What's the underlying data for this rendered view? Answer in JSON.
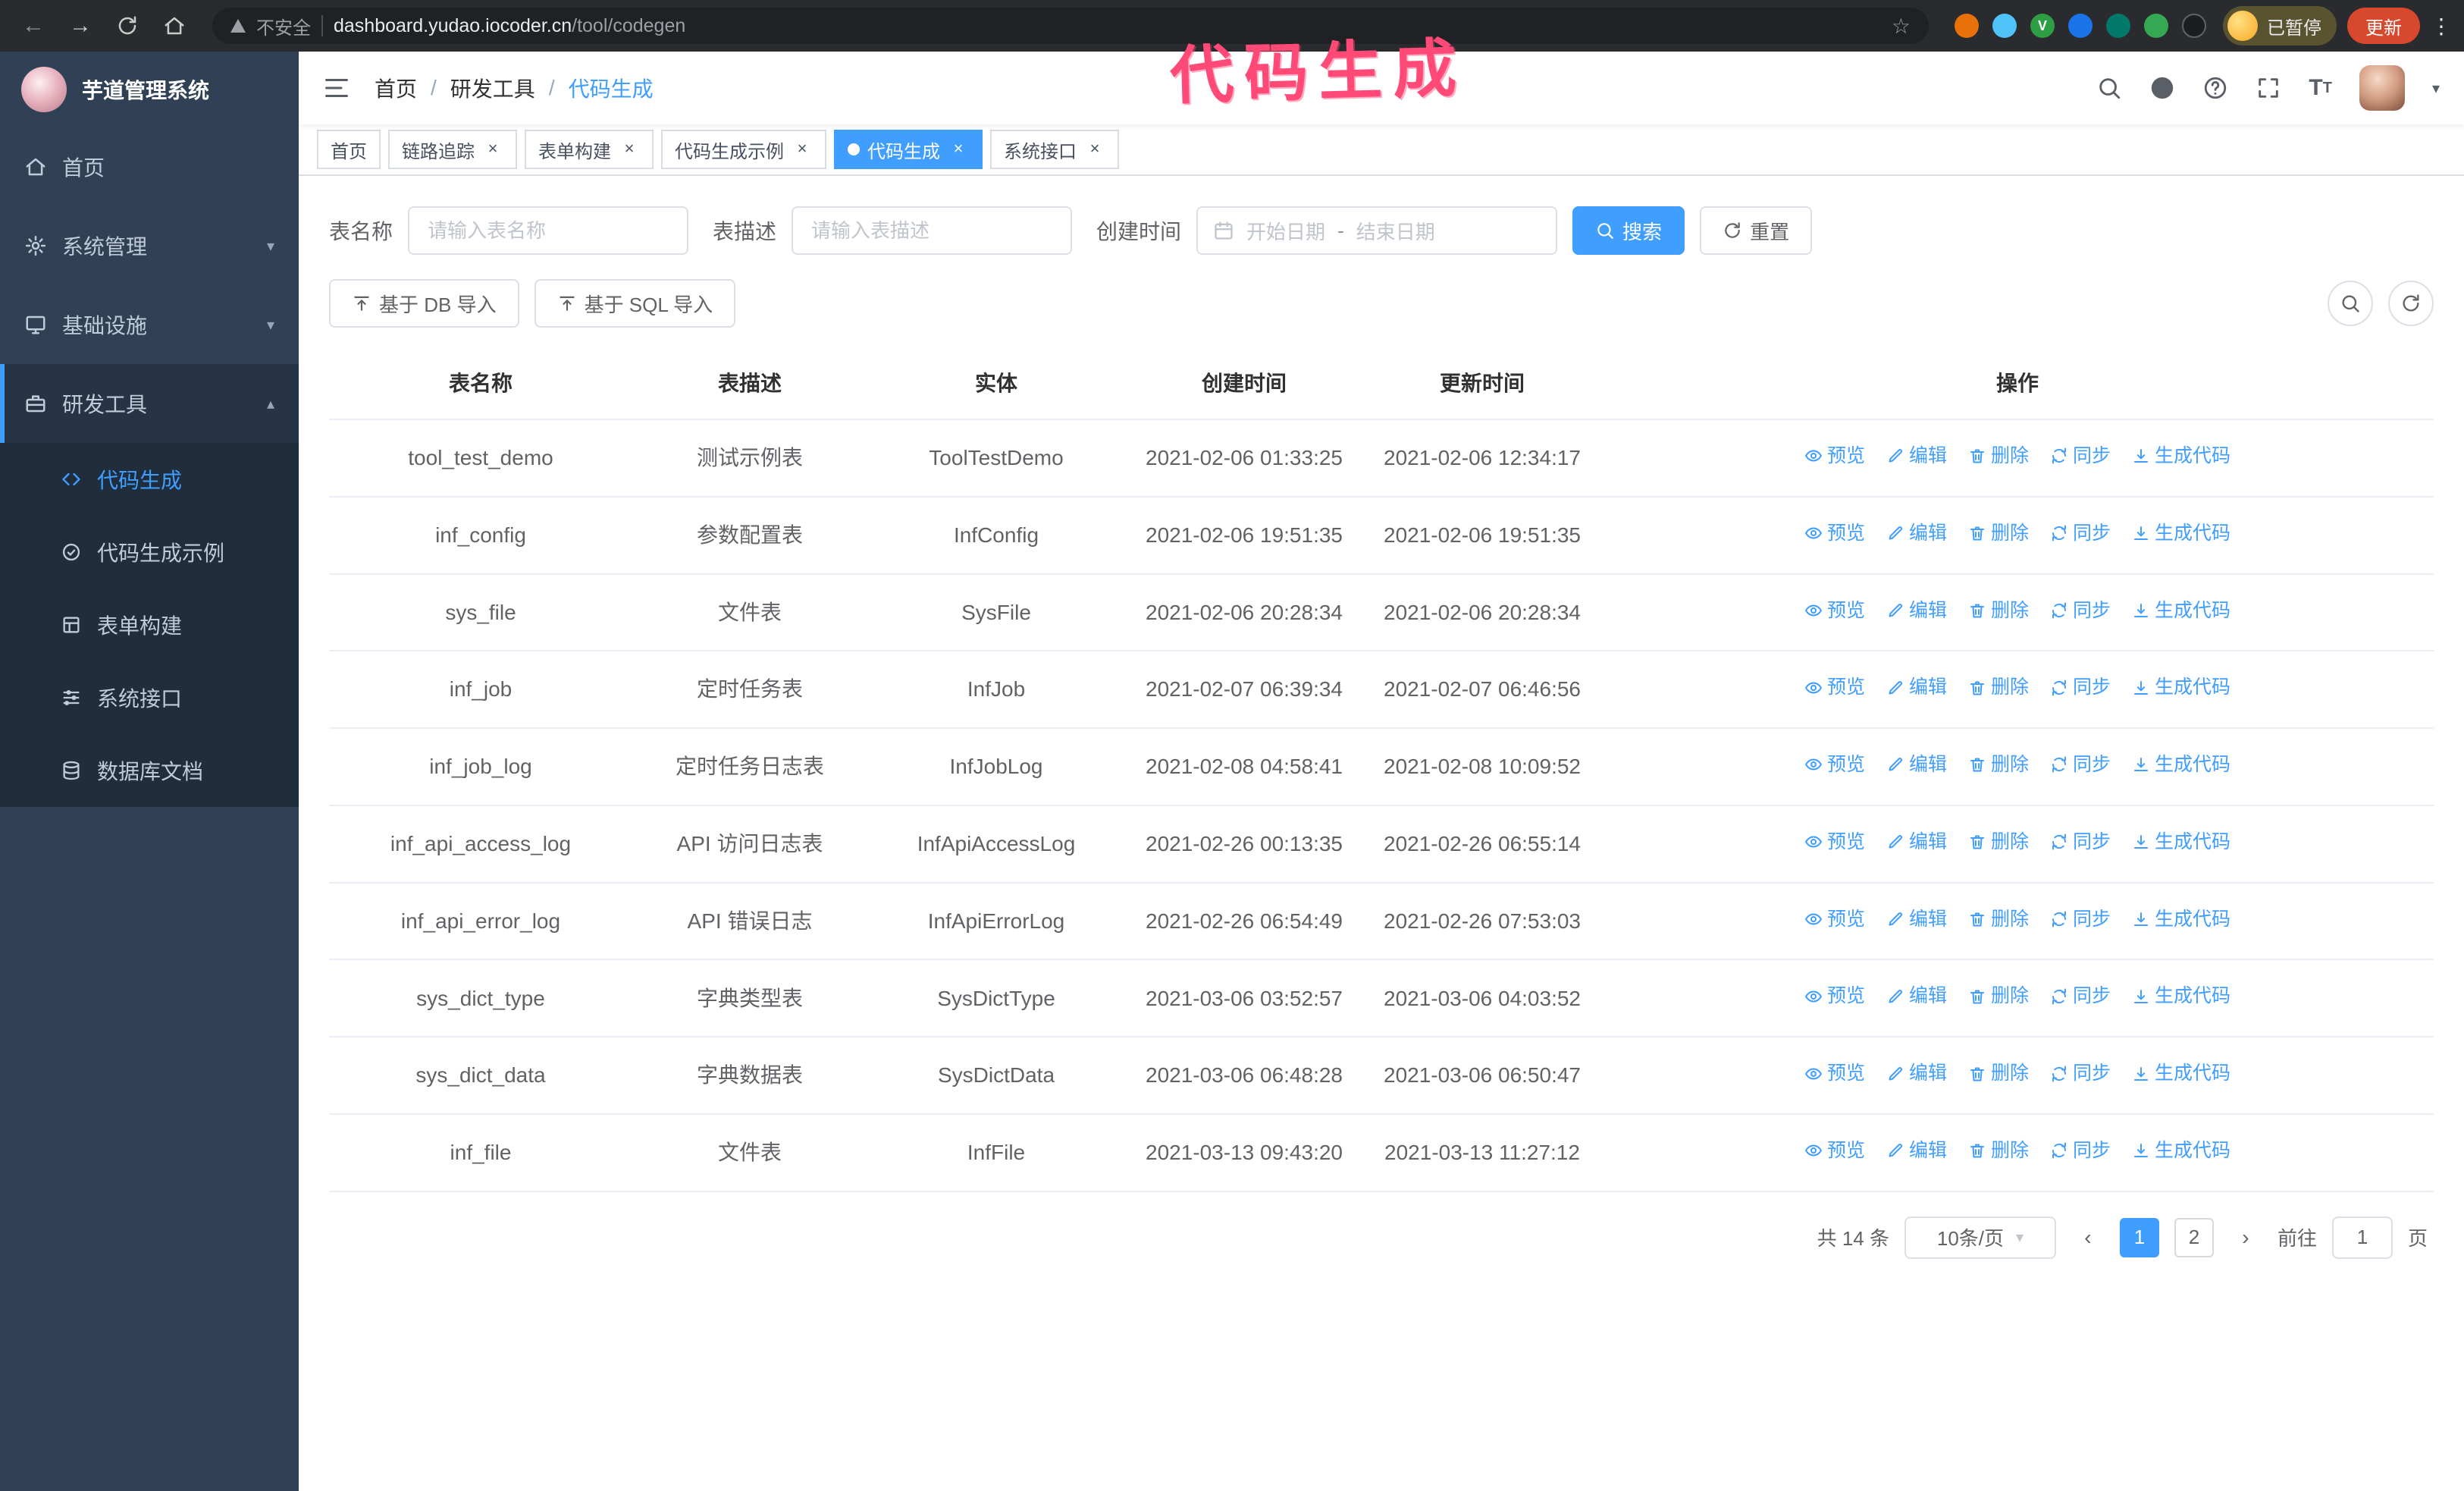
{
  "browser": {
    "security_text": "不安全",
    "url_host": "dashboard.yudao.iocoder.cn",
    "url_path": "/tool/codegen",
    "profile_status": "已暂停",
    "update_label": "更新"
  },
  "annotation": {
    "text": "代码生成",
    "color": "#ff4a78"
  },
  "sidebar": {
    "logo_title": "芋道管理系统",
    "items": [
      {
        "label": "首页",
        "icon": "home-icon"
      },
      {
        "label": "系统管理",
        "icon": "gear-icon"
      },
      {
        "label": "基础设施",
        "icon": "monitor-icon"
      },
      {
        "label": "研发工具",
        "icon": "toolbox-icon",
        "expanded": true
      }
    ],
    "sub_items": [
      {
        "label": "代码生成",
        "icon": "code-icon",
        "active": true
      },
      {
        "label": "代码生成示例",
        "icon": "example-icon"
      },
      {
        "label": "表单构建",
        "icon": "form-icon"
      },
      {
        "label": "系统接口",
        "icon": "api-icon"
      },
      {
        "label": "数据库文档",
        "icon": "database-icon"
      }
    ]
  },
  "breadcrumb": {
    "separator": "/",
    "items": [
      "首页",
      "研发工具",
      "代码生成"
    ]
  },
  "tabs": [
    {
      "label": "首页",
      "closable": false,
      "active": false
    },
    {
      "label": "链路追踪",
      "closable": true,
      "active": false
    },
    {
      "label": "表单构建",
      "closable": true,
      "active": false
    },
    {
      "label": "代码生成示例",
      "closable": true,
      "active": false
    },
    {
      "label": "代码生成",
      "closable": true,
      "active": true
    },
    {
      "label": "系统接口",
      "closable": true,
      "active": false
    }
  ],
  "filters": {
    "table_name_label": "表名称",
    "table_name_placeholder": "请输入表名称",
    "table_desc_label": "表描述",
    "table_desc_placeholder": "请输入表描述",
    "create_time_label": "创建时间",
    "date_start_placeholder": "开始日期",
    "date_separator": "-",
    "date_end_placeholder": "结束日期",
    "search_label": "搜索",
    "reset_label": "重置"
  },
  "toolbar": {
    "import_db_label": "基于 DB 导入",
    "import_sql_label": "基于 SQL 导入"
  },
  "table": {
    "columns": [
      "表名称",
      "表描述",
      "实体",
      "创建时间",
      "更新时间",
      "操作"
    ],
    "actions": [
      {
        "id": "preview",
        "label": "预览",
        "icon": "i-eye"
      },
      {
        "id": "edit",
        "label": "编辑",
        "icon": "i-edit"
      },
      {
        "id": "delete",
        "label": "删除",
        "icon": "i-trash"
      },
      {
        "id": "sync",
        "label": "同步",
        "icon": "i-sync"
      },
      {
        "id": "generate",
        "label": "生成代码",
        "icon": "i-download"
      }
    ],
    "rows": [
      {
        "name": "tool_test_demo",
        "desc": "测试示例表",
        "entity": "ToolTestDemo",
        "created": "2021-02-06 01:33:25",
        "updated": "2021-02-06 12:34:17"
      },
      {
        "name": "inf_config",
        "desc": "参数配置表",
        "entity": "InfConfig",
        "created": "2021-02-06 19:51:35",
        "updated": "2021-02-06 19:51:35"
      },
      {
        "name": "sys_file",
        "desc": "文件表",
        "entity": "SysFile",
        "created": "2021-02-06 20:28:34",
        "updated": "2021-02-06 20:28:34"
      },
      {
        "name": "inf_job",
        "desc": "定时任务表",
        "entity": "InfJob",
        "created": "2021-02-07 06:39:34",
        "updated": "2021-02-07 06:46:56"
      },
      {
        "name": "inf_job_log",
        "desc": "定时任务日志表",
        "entity": "InfJobLog",
        "created": "2021-02-08 04:58:41",
        "updated": "2021-02-08 10:09:52"
      },
      {
        "name": "inf_api_access_log",
        "desc": "API 访问日志表",
        "entity": "InfApiAccessLog",
        "created": "2021-02-26 00:13:35",
        "updated": "2021-02-26 06:55:14"
      },
      {
        "name": "inf_api_error_log",
        "desc": "API 错误日志",
        "entity": "InfApiErrorLog",
        "created": "2021-02-26 06:54:49",
        "updated": "2021-02-26 07:53:03"
      },
      {
        "name": "sys_dict_type",
        "desc": "字典类型表",
        "entity": "SysDictType",
        "created": "2021-03-06 03:52:57",
        "updated": "2021-03-06 04:03:52"
      },
      {
        "name": "sys_dict_data",
        "desc": "字典数据表",
        "entity": "SysDictData",
        "created": "2021-03-06 06:48:28",
        "updated": "2021-03-06 06:50:47"
      },
      {
        "name": "inf_file",
        "desc": "文件表",
        "entity": "InfFile",
        "created": "2021-03-13 09:43:20",
        "updated": "2021-03-13 11:27:12"
      }
    ]
  },
  "pagination": {
    "total_text": "共 14 条",
    "page_size": "10条/页",
    "pages": [
      "1",
      "2"
    ],
    "active_page": "1",
    "goto_label": "前往",
    "goto_value": "1",
    "goto_unit": "页"
  },
  "colors": {
    "accent": "#409EFF",
    "sidebar_bg": "#304156",
    "submenu_bg": "#1f2d3d",
    "annotation_pink": "#ff4a78",
    "chrome_bar": "#2a2b2e",
    "update_button": "#d8482c"
  }
}
